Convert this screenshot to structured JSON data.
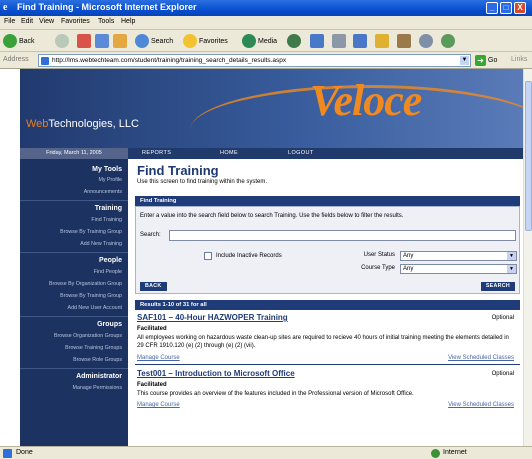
{
  "window": {
    "title": "Find Training - Microsoft Internet Explorer",
    "min": "_",
    "max": "□",
    "close": "X"
  },
  "menu": [
    "File",
    "Edit",
    "View",
    "Favorites",
    "Tools",
    "Help"
  ],
  "toolbar": {
    "back": "Back",
    "search": "Search",
    "favorites": "Favorites",
    "media": "Media"
  },
  "address": {
    "label": "Address",
    "url": "http://lms.webtechteam.com/student/training/training_search_details_results.aspx",
    "go": "Go",
    "links": "Links"
  },
  "site": {
    "company": "Technologies, LLC",
    "company_prefix": "Web",
    "logo": "Veloce",
    "date": "Friday, March 11, 2005",
    "nav": [
      "REPORTS",
      "HOME",
      "LOGOUT"
    ]
  },
  "sidebar": {
    "my_tools": {
      "heading": "My Tools",
      "items": [
        "My Profile",
        "Announcements"
      ]
    },
    "training": {
      "heading": "Training",
      "items": [
        "Find Training",
        "Browse By Training Group",
        "Add New Training"
      ]
    },
    "people": {
      "heading": "People",
      "items": [
        "Find People",
        "Browse By Organization Group",
        "Browse By Training Group",
        "Add New User Account"
      ]
    },
    "groups": {
      "heading": "Groups",
      "items": [
        "Browse Organization Groups",
        "Browse Training Groups",
        "Browse Role Groups"
      ]
    },
    "administrator": {
      "heading": "Administrator",
      "items": [
        "Manage Permissions"
      ]
    }
  },
  "main": {
    "title": "Find Training",
    "subtitle": "Use this screen to find training within the system.",
    "panel": {
      "heading": "Find Training",
      "hint": "Enter a value into the search field below to search Training. Use the fields below to filter the results.",
      "search_label": "Search:",
      "search_value": "",
      "inactive_label": "Include Inactive Records",
      "user_status_label": "User Status",
      "user_status_value": "Any",
      "course_type_label": "Course Type",
      "course_type_value": "Any",
      "back_button": "BACK",
      "search_button": "SEARCH"
    },
    "results_heading": "Results 1-10 of 31 for all",
    "results": [
      {
        "title": "SAF101 – 40-Hour HAZWOPER Training",
        "optional": "Optional",
        "type": "Facilitated",
        "description": "All employees working on hazardous waste clean-up sites are required to recieve 40 hours of initial training meeting the elements detailed in 29 CFR 1910.120 (e) (2) through (e) (2) (vii).",
        "manage": "Manage Course",
        "view": "View Scheduled Classes"
      },
      {
        "title": "Test001 – Introduction to Microsoft Office",
        "optional": "Optional",
        "type": "Facilitated",
        "description": "This course provides an overview of the features included in the Professional version of Microsoft Office.",
        "manage": "Manage Course",
        "view": "View Scheduled Classes"
      }
    ]
  },
  "status": {
    "text": "Done",
    "zone": "Internet"
  }
}
